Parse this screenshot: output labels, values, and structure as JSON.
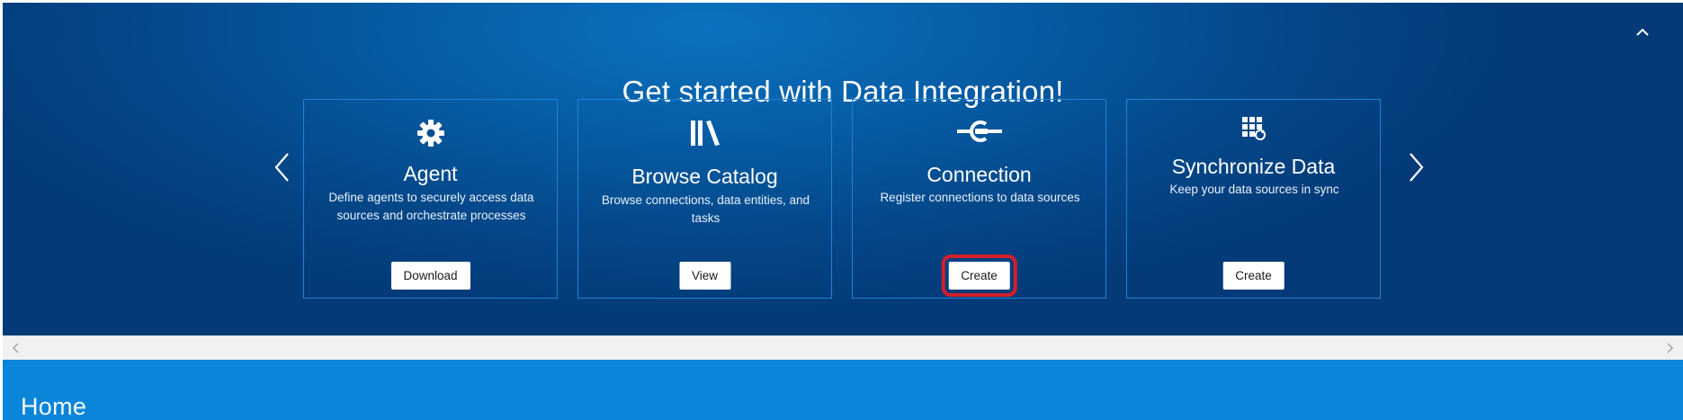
{
  "banner": {
    "title": "Get started with Data Integration!",
    "collapse_icon": "chevron-up-icon",
    "prev_icon": "chevron-left-icon",
    "next_icon": "chevron-right-icon"
  },
  "cards": [
    {
      "icon": "gear-icon",
      "title": "Agent",
      "description": "Define agents to securely access data sources and orchestrate processes",
      "button_label": "Download"
    },
    {
      "icon": "library-books-icon",
      "title": "Browse Catalog",
      "description": "Browse connections, data entities, and tasks",
      "button_label": "View"
    },
    {
      "icon": "connection-plug-icon",
      "title": "Connection",
      "description": "Register connections to data sources",
      "button_label": "Create"
    },
    {
      "icon": "grid-sync-icon",
      "title": "Synchronize Data",
      "description": "Keep your data sources in sync",
      "button_label": "Create"
    }
  ],
  "scrollbar": {
    "left_icon": "scroll-left-icon",
    "right_icon": "scroll-right-icon"
  },
  "home_bar": {
    "title": "Home"
  },
  "colors": {
    "banner_dark": "#033a77",
    "banner_light": "#0a72c0",
    "card_border": "#1f82d6",
    "home_bar": "#0a85d9",
    "highlight": "#d21f2b"
  }
}
